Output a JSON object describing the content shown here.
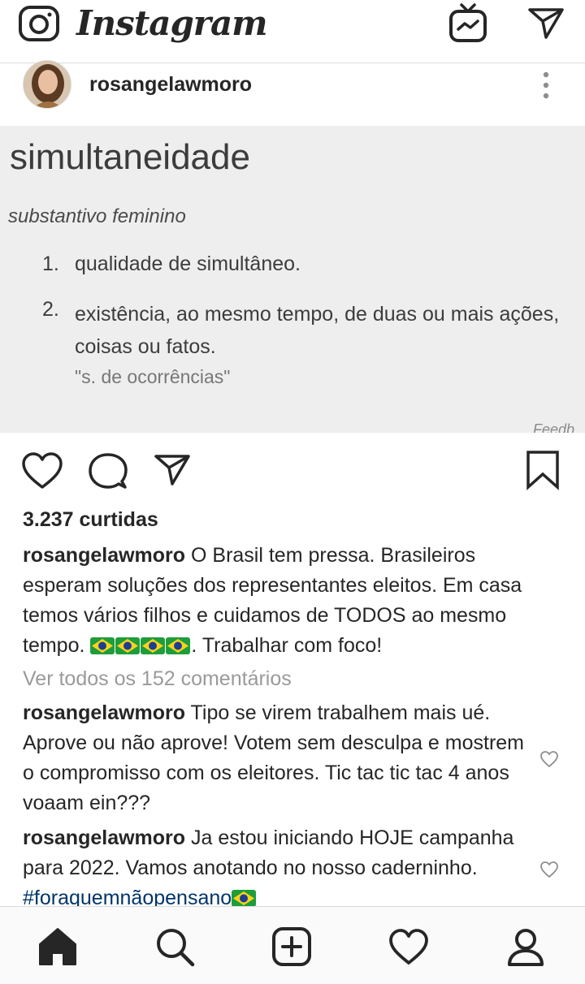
{
  "app": {
    "logo": "Instagram"
  },
  "post": {
    "username": "rosangelawmoro",
    "image": {
      "word": "simultaneidade",
      "class": "substantivo feminino",
      "definitions": [
        {
          "num": "1.",
          "text": "qualidade de simultâneo."
        },
        {
          "num": "2.",
          "text": "existência, ao mesmo tempo, de duas ou mais ações, coisas ou fatos."
        }
      ],
      "example": "\"s. de ocorrências\"",
      "feedback": "Feedb"
    },
    "likes": "3.237 curtidas",
    "caption": {
      "username": "rosangelawmoro",
      "text_before_flags": " O Brasil tem pressa. Brasileiros esperam soluções dos representantes eleitos. Em casa temos vários filhos e cuidamos de TODOS ao mesmo tempo. ",
      "text_after_flags": ". Trabalhar com foco!"
    },
    "view_all": "Ver todos os 152 comentários",
    "comments": [
      {
        "username": "rosangelawmoro",
        "text": " Tipo se virem trabalhem mais ué. Aprove ou não aprove! Votem sem desculpa e mostrem o compromisso com os eleitores. Tic tac tic tac 4 anos voaam ein???"
      },
      {
        "username": "rosangelawmoro",
        "text": " Ja estou iniciando HOJE campanha para 2022. Vamos anotando no nosso caderninho. ",
        "hashtag": "#foraquemnãopensano"
      }
    ]
  },
  "icons": {
    "top": [
      "camera-icon",
      "igtv-icon",
      "direct-message-icon"
    ],
    "actions": [
      "heart-icon",
      "comment-icon",
      "share-icon",
      "bookmark-icon"
    ],
    "nav": [
      "home-icon",
      "search-icon",
      "add-post-icon",
      "activity-heart-icon",
      "profile-icon"
    ]
  },
  "colors": {
    "text": "#262626",
    "muted": "#9a9a9a",
    "hashtag": "#003569",
    "image_bg": "#eeeeee"
  }
}
